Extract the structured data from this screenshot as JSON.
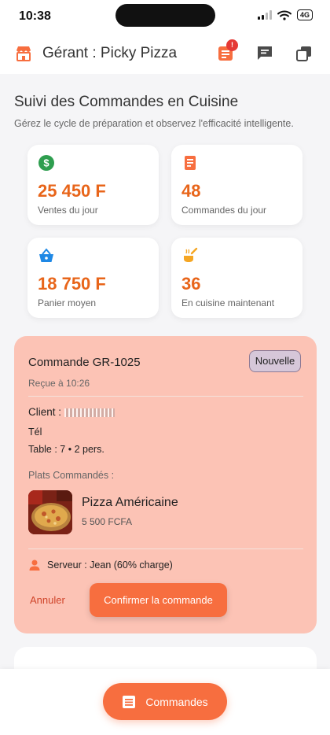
{
  "status_bar": {
    "time": "10:38",
    "network": "4G"
  },
  "header": {
    "title": "Gérant : Picky Pizza",
    "notification_count": "!"
  },
  "page": {
    "title": "Suivi des Commandes en Cuisine",
    "subtitle": "Gérez le cycle de préparation et observez l'efficacité intelligente."
  },
  "stats": [
    {
      "icon": "dollar-icon",
      "value": "25 450 F",
      "label": "Ventes du jour"
    },
    {
      "icon": "receipt-icon",
      "value": "48",
      "label": "Commandes du jour"
    },
    {
      "icon": "basket-icon",
      "value": "18 750 F",
      "label": "Panier moyen"
    },
    {
      "icon": "cooking-icon",
      "value": "36",
      "label": "En cuisine maintenant"
    }
  ],
  "order": {
    "title": "Commande GR-1025",
    "status": "Nouvelle",
    "received": "Reçue à 10:26",
    "client_label": "Client :",
    "tel_label": "Tél",
    "table": "Table : 7 • 2 pers.",
    "dishes_label": "Plats Commandés :",
    "dish_name": "Pizza Américaine",
    "dish_price": "5 500 FCFA",
    "server": "Serveur : Jean (60% charge)",
    "cancel_label": "Annuler",
    "confirm_label": "Confirmer la commande"
  },
  "bottom_nav": {
    "orders_label": "Commandes"
  },
  "colors": {
    "accent": "#f76e3f",
    "stat_value": "#e8651a",
    "order_card_bg": "#fcc3b5",
    "status_chip_bg": "#d6c7d9",
    "money_green": "#2e9e4f",
    "basket_blue": "#1e88e5"
  }
}
